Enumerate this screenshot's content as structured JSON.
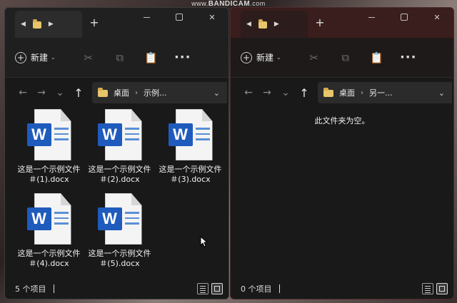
{
  "watermark": {
    "prefix": "www.",
    "brand": "BANDICAM",
    "suffix": ".com"
  },
  "left_window": {
    "tab": {
      "back": "◀",
      "forward": "▶"
    },
    "new_tab": "+",
    "caption": {
      "close": "✕"
    },
    "toolbar": {
      "new_label": "新建"
    },
    "address": {
      "segment1": "桌面",
      "separator": "›",
      "segment2": "示例..."
    },
    "files": [
      {
        "name": "这是一个示例文件＃(1).docx"
      },
      {
        "name": "这是一个示例文件＃(2).docx"
      },
      {
        "name": "这是一个示例文件＃(3).docx"
      },
      {
        "name": "这是一个示例文件＃(4).docx"
      },
      {
        "name": "这是一个示例文件＃(5).docx"
      }
    ],
    "status": {
      "item_count": "5 个项目"
    }
  },
  "right_window": {
    "tab": {
      "back": "◀",
      "forward": "▶"
    },
    "new_tab": "+",
    "caption": {
      "close": "✕"
    },
    "toolbar": {
      "new_label": "新建"
    },
    "address": {
      "segment1": "桌面",
      "separator": "›",
      "segment2": "另一..."
    },
    "empty_message": "此文件夹为空。",
    "status": {
      "item_count": "0 个项目"
    }
  },
  "icons": {
    "word_letter": "W",
    "nav_back": "←",
    "nav_forward": "→",
    "nav_recent": "⌄",
    "nav_up": "↑",
    "address_caret": "⌄",
    "cut": "✂",
    "copy": "⧉",
    "paste": "📋",
    "more": "···",
    "plus": "+",
    "new_chevron": "⌄"
  },
  "colors": {
    "word_blue": "#1f5bbd",
    "folder_yellow": "#e8c46a",
    "accent_dark_red": "#3a1d1d"
  }
}
